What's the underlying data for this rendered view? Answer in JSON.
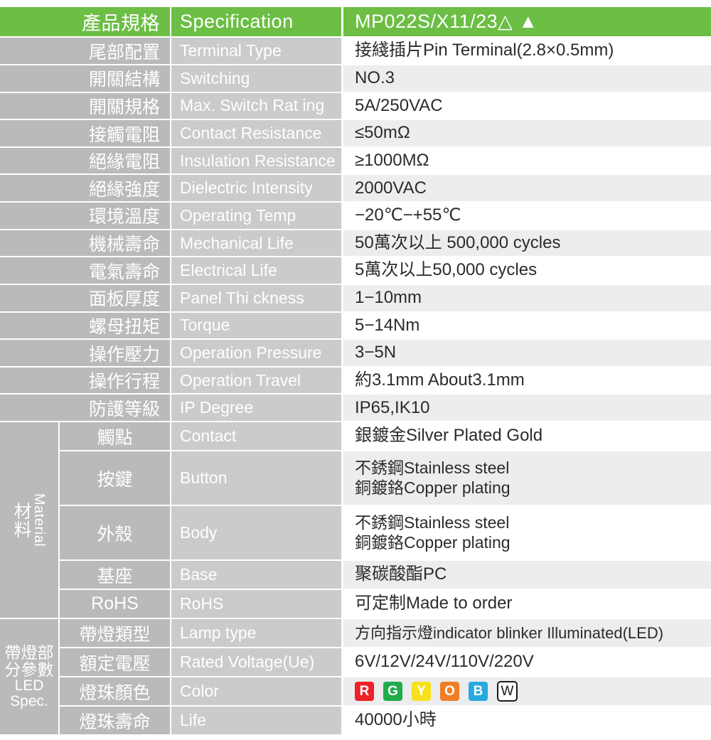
{
  "header": {
    "cn": "產品規格",
    "en": "Specification",
    "value": "MP022S/X11/23△ ▲",
    "bg_color": "#6cbe45"
  },
  "colors": {
    "label_cn_bg": "#b8babb",
    "label_en_bg": "#c9cbcc",
    "value_bg": "#ffffff",
    "value_alt_bg": "#ebedee",
    "header_green": "#6cbe45",
    "text_dark": "#2b2b2b"
  },
  "rows": [
    {
      "cn": "尾部配置",
      "en": "Terminal Type",
      "value": "接綫插片Pin Terminal(2.8×0.5mm)"
    },
    {
      "cn": "開關結構",
      "en": "Switching",
      "value": "NO.3"
    },
    {
      "cn": "開關規格",
      "en": "Max. Switch Rat ing",
      "value": "5A/250VAC"
    },
    {
      "cn": "接觸電阻",
      "en": "Contact Resistance",
      "value": "≤50mΩ"
    },
    {
      "cn": "絕緣電阻",
      "en": "Insulation Resistance",
      "value": "≥1000MΩ"
    },
    {
      "cn": "絕緣強度",
      "en": "Dielectric Intensity",
      "value": "2000VAC"
    },
    {
      "cn": "環境溫度",
      "en": "Operating Temp",
      "value": "−20℃−+55℃"
    },
    {
      "cn": "機械壽命",
      "en": "Mechanical Life",
      "value": "50萬次以上 500,000  cycles"
    },
    {
      "cn": "電氣壽命",
      "en": "Electrical Life",
      "value": "5萬次以上50,000 cycles"
    },
    {
      "cn": "面板厚度",
      "en": "Panel Thi ckness",
      "value": "1−10mm"
    },
    {
      "cn": "螺母扭矩",
      "en": "Torque",
      "value": "5−14Nm"
    },
    {
      "cn": "操作壓力",
      "en": "Operation Pressure",
      "value": "3−5N"
    },
    {
      "cn": "操作行程",
      "en": "Operation Travel",
      "value": "約3.1mm  About3.1mm"
    },
    {
      "cn": "防護等級",
      "en": "IP Degree",
      "value": "IP65,IK10"
    }
  ],
  "material": {
    "label_cn": "材料",
    "label_en": "Material",
    "rows": [
      {
        "cn": "觸點",
        "en": "Contact",
        "value": "銀鍍金Silver Plated Gold"
      },
      {
        "cn": "按鍵",
        "en": "Button",
        "value": "不銹鋼Stainless steel\n銅鍍鉻Copper plating"
      },
      {
        "cn": "外殼",
        "en": "Body",
        "value": "不銹鋼Stainless steel\n銅鍍鉻Copper plating"
      },
      {
        "cn": "基座",
        "en": "Base",
        "value": "聚碳酸酯PC"
      },
      {
        "cn": "RoHS",
        "en": "RoHS",
        "value": "可定制Made to order"
      }
    ]
  },
  "led": {
    "label_cn": "帶燈部分參數",
    "label_en_line1": "LED",
    "label_en_line2": "Spec.",
    "rows": [
      {
        "cn": "帶燈類型",
        "en": "Lamp type",
        "value": "方向指示燈indicator blinker Illuminated(LED)"
      },
      {
        "cn": "額定電壓",
        "en": "Rated Voltage(Ue)",
        "value": "6V/12V/24V/110V/220V"
      },
      {
        "cn": "燈珠顏色",
        "en": "Color",
        "value": ""
      },
      {
        "cn": "燈珠壽命",
        "en": "Life",
        "value": "40000小時"
      }
    ],
    "color_chips": [
      {
        "label": "R",
        "color": "#ec2227"
      },
      {
        "label": "G",
        "color": "#22ab4b"
      },
      {
        "label": "Y",
        "color": "#f5e21d"
      },
      {
        "label": "O",
        "color": "#f07e26"
      },
      {
        "label": "B",
        "color": "#27a9e1"
      },
      {
        "label": "W",
        "color": "#ffffff"
      }
    ]
  }
}
